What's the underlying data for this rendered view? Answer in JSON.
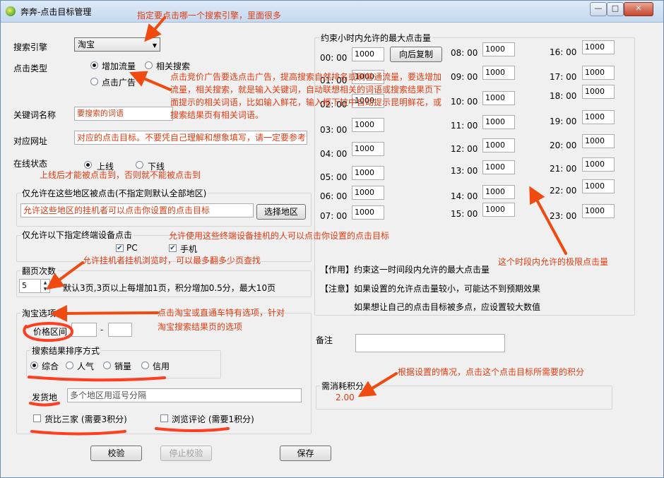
{
  "window": {
    "title": "奔奔-点击目标管理",
    "controls": [
      "—",
      "□",
      "✕"
    ]
  },
  "annotations": {
    "engine_note": "指定要点击哪一个搜索引擎，里面很多",
    "clicktype_note": "点击竞价广告要选点击广告，提高搜索自然排名或刷普通流量，要选增加流量，相关搜索，就是输入关键词，自动联想相关的词语或搜索结果页下面提示的相关词语，比如输入鲜花，输入框下拉中自动提示昆明鲜花，或搜索结果页有相关词语。",
    "online_note": "上线后才能被点击到，否则就不能被点击到",
    "device_note": "允许使用这些终端设备挂机的人可以点击你设置的点击目标",
    "pages_note": "允许挂机者挂机浏览时，可以最多翻多少页查找",
    "taobao_note": "点击淘宝或直通车特有选项，针对淘宝搜索结果页的选项",
    "hour_note": "这个时段内允许的极限点击量",
    "points_note": "根据设置的情况，点击这个点击目标所需要的积分"
  },
  "form": {
    "engine_label": "搜索引擎",
    "engine_value": "淘宝",
    "clicktype_label": "点击类型",
    "opt_add_traffic": "增加流量",
    "opt_related": "相关搜索",
    "opt_ad": "点击广告",
    "keyword_label": "关键词名称",
    "keyword_value": "要搜索的词语",
    "url_label": "对应网址",
    "url_value": "对应的点击目标。不要凭自己理解和想象填写，请一定要参考详细教程",
    "status_label": "在线状态",
    "opt_online": "上线",
    "opt_offline": "下线",
    "region_group": "仅允许在这些地区被点击(不指定则默认全部地区)",
    "region_value": "允许这些地区的挂机者可以点击你设置的点击目标",
    "region_button": "选择地区",
    "device_group": "仅允许以下指定终端设备点击",
    "device_pc": "PC",
    "device_mobile": "手机",
    "pages_group": "翻页次数",
    "pages_value": "5",
    "pages_hint": "默认3页,3页以上每增加1页，积分增加0.5分，最大10页",
    "taobao_group": "淘宝选项",
    "price_label": "价格区间",
    "price_dash": "-",
    "sort_group": "搜索结果排序方式",
    "sort_all": "综合",
    "sort_pop": "人气",
    "sort_sales": "销量",
    "sort_credit": "信用",
    "ship_label": "发货地",
    "ship_placeholder": "多个地区用逗号分隔",
    "compare_label": "货比三家 (需要3积分)",
    "review_label": "浏览评论 (需要1积分)",
    "check_button": "校验",
    "stop_check_button": "停止校验",
    "save_button": "保存"
  },
  "hourly": {
    "group": "约束小时内允许的最大点击量",
    "copy_button": "向后复制",
    "hours": [
      {
        "label": "00: 00",
        "value": "1000"
      },
      {
        "label": "01: 00",
        "value": "1000"
      },
      {
        "label": "02: 00",
        "value": "1000"
      },
      {
        "label": "03: 00",
        "value": "1000"
      },
      {
        "label": "04: 00",
        "value": "1000"
      },
      {
        "label": "05: 00",
        "value": "1000"
      },
      {
        "label": "06: 00",
        "value": "1000"
      },
      {
        "label": "07: 00",
        "value": "1000"
      },
      {
        "label": "08: 00",
        "value": "1000"
      },
      {
        "label": "09: 00",
        "value": "1000"
      },
      {
        "label": "10: 00",
        "value": "1000"
      },
      {
        "label": "11: 00",
        "value": "1000"
      },
      {
        "label": "12: 00",
        "value": "1000"
      },
      {
        "label": "13: 00",
        "value": "1000"
      },
      {
        "label": "14: 00",
        "value": "1000"
      },
      {
        "label": "15: 00",
        "value": "1000"
      },
      {
        "label": "16: 00",
        "value": "1000"
      },
      {
        "label": "17: 00",
        "value": "1000"
      },
      {
        "label": "18: 00",
        "value": "1000"
      },
      {
        "label": "19: 00",
        "value": "1000"
      },
      {
        "label": "20: 00",
        "value": "1000"
      },
      {
        "label": "21: 00",
        "value": "1000"
      },
      {
        "label": "22: 00",
        "value": "1000"
      },
      {
        "label": "23: 00",
        "value": "1000"
      }
    ],
    "info1": "【作用】约束这一时间段内允许的最大点击量",
    "info2": "【注意】如果设置的允许点击量较小，可能达不到预期效果",
    "info3": "如果想让自己的点击目标被多点，应设置较大数值"
  },
  "remark_label": "备注",
  "points": {
    "label": "需消耗积分",
    "value": "2.00"
  }
}
